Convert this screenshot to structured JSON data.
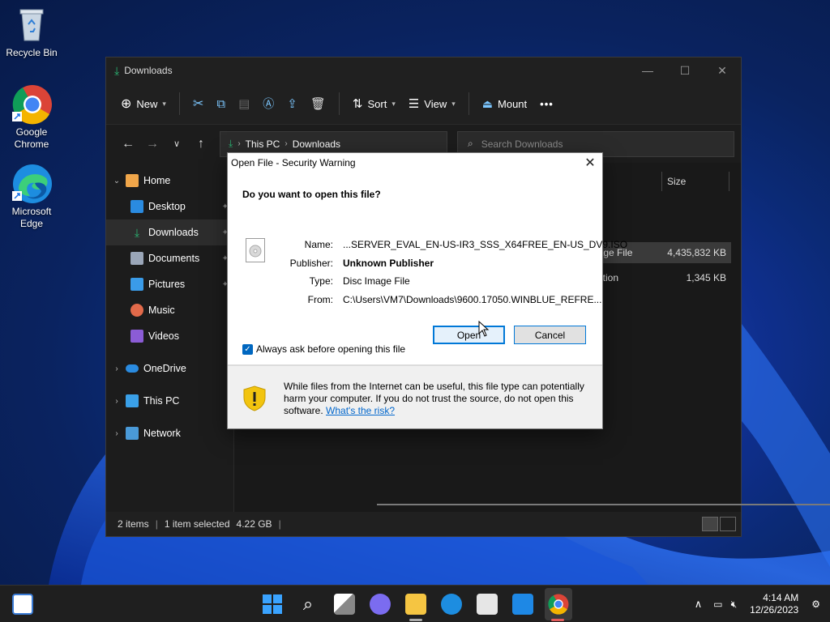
{
  "desktop": {
    "icons": [
      {
        "label": "Recycle Bin",
        "icon": "recycle-bin-icon"
      },
      {
        "label": "Google\nChrome",
        "icon": "chrome-icon"
      },
      {
        "label": "Microsoft\nEdge",
        "icon": "edge-icon"
      }
    ]
  },
  "explorer": {
    "title": "Downloads",
    "cmdbar": {
      "new": "New",
      "sort": "Sort",
      "view": "View",
      "mount": "Mount",
      "more": "•••"
    },
    "address": {
      "this_pc": "This PC",
      "downloads": "Downloads"
    },
    "search_placeholder": "Search Downloads",
    "sidebar": [
      {
        "label": "Home",
        "expanded": true
      },
      {
        "label": "Desktop"
      },
      {
        "label": "Downloads",
        "selected": true
      },
      {
        "label": "Documents"
      },
      {
        "label": "Pictures"
      },
      {
        "label": "Music"
      },
      {
        "label": "Videos"
      },
      {
        "label": "OneDrive"
      },
      {
        "label": "This PC"
      },
      {
        "label": "Network"
      }
    ],
    "columns": {
      "size": "Size"
    },
    "files": [
      {
        "type_fragment": "nage File",
        "size": "4,435,832 KB",
        "selected": true
      },
      {
        "type_fragment": "cation",
        "size": "1,345 KB",
        "selected": false
      }
    ],
    "status": {
      "items": "2 items",
      "selected": "1 item selected",
      "size": "4.22 GB"
    }
  },
  "dialog": {
    "title": "Open File - Security Warning",
    "question": "Do you want to open this file?",
    "fields": {
      "name_label": "Name:",
      "name_value": "...SERVER_EVAL_EN-US-IR3_SSS_X64FREE_EN-US_DV9.ISO",
      "publisher_label": "Publisher:",
      "publisher_value": "Unknown Publisher",
      "type_label": "Type:",
      "type_value": "Disc Image File",
      "from_label": "From:",
      "from_value": "C:\\Users\\VM7\\Downloads\\9600.17050.WINBLUE_REFRE..."
    },
    "open_button": "Open",
    "cancel_button": "Cancel",
    "checkbox_label": "Always ask before opening this file",
    "checkbox_checked": true,
    "warning_text": "While files from the Internet can be useful, this file type can potentially harm your computer. If you do not trust the source, do not open this software.",
    "risk_link": "What's the risk?"
  },
  "taskbar": {
    "time": "4:14 AM",
    "date": "12/26/2023"
  },
  "colors": {
    "accent": "#0078d7",
    "dark_bg": "#202020",
    "dialog_bg": "#f0f0f0",
    "link": "#0066cc"
  }
}
